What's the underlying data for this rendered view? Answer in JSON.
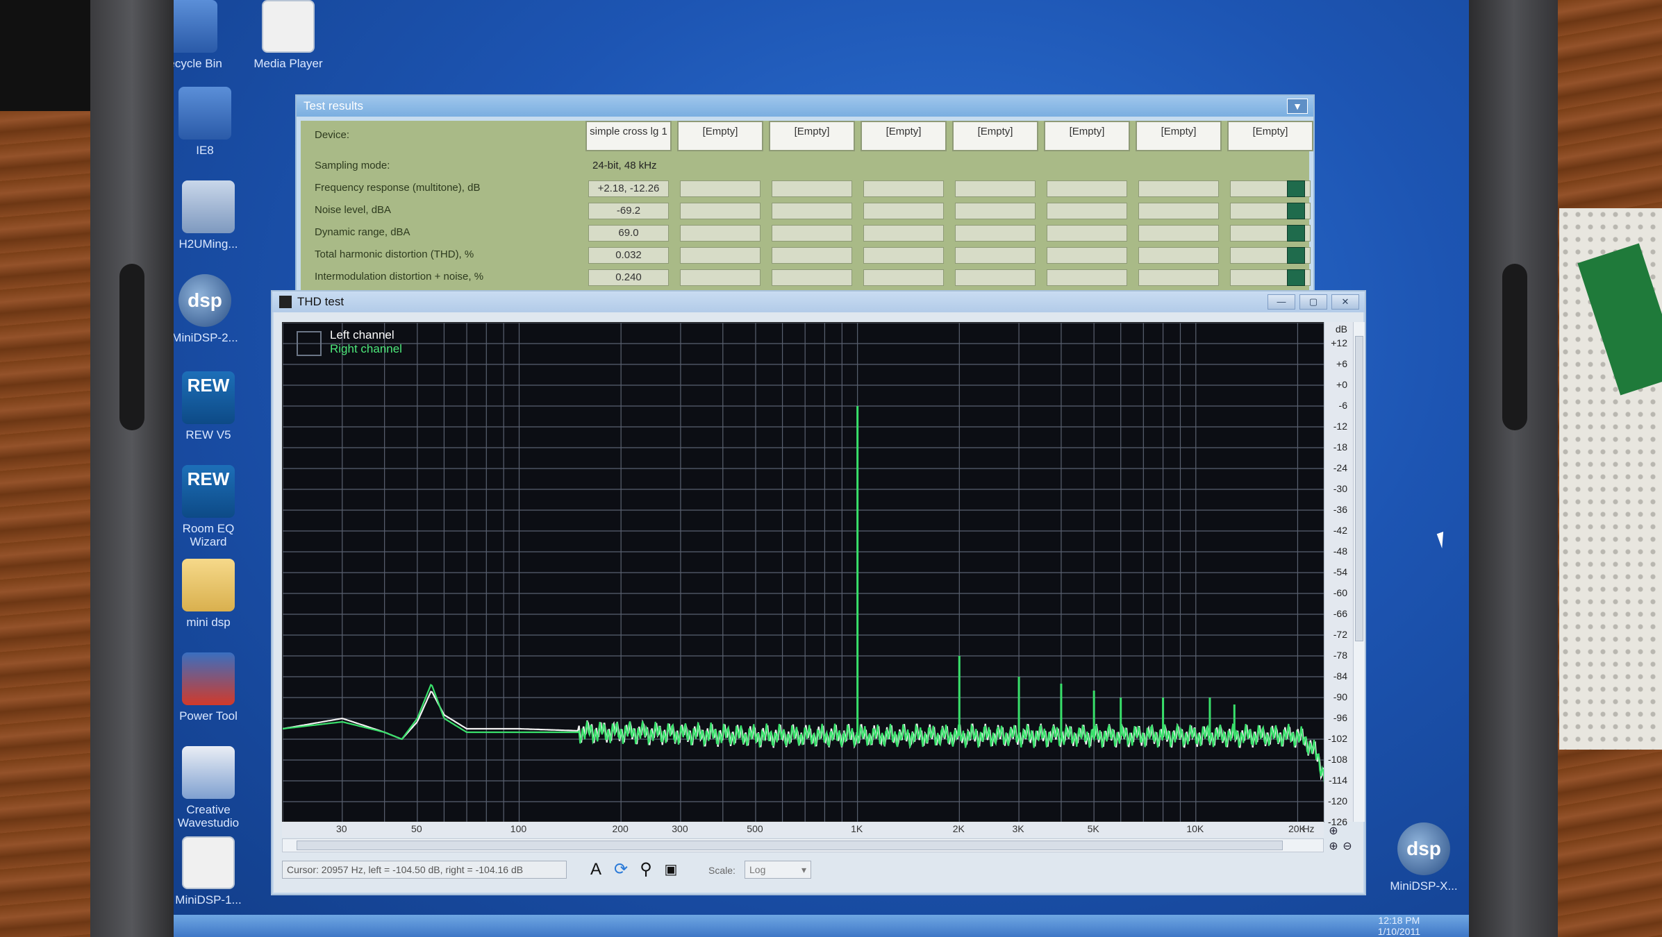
{
  "desktop": {
    "icons": [
      {
        "label": "Recycle Bin",
        "icon": "recycle-bin-icon"
      },
      {
        "label": "Media Player",
        "icon": "media-icon"
      },
      {
        "label": "IE8",
        "icon": "computer-icon"
      },
      {
        "label": "H2UMing...",
        "icon": "utility-icon"
      },
      {
        "label": "MiniDSP-2...",
        "icon": "minidsp-icon"
      },
      {
        "label": "REW V5",
        "icon": "rew-icon"
      },
      {
        "label": "Room EQ Wizard",
        "icon": "rew-icon"
      },
      {
        "label": "mini dsp",
        "icon": "folder-icon"
      },
      {
        "label": "Power Tool",
        "icon": "power-icon"
      },
      {
        "label": "Creative Wavestudio",
        "icon": "pen-icon"
      },
      {
        "label": "MiniDSP-1...",
        "icon": "document-icon"
      },
      {
        "label": "MiniDSP-X...",
        "icon": "minidsp-icon"
      }
    ],
    "rew_text": "REW"
  },
  "test_results": {
    "title": "Test results",
    "device_label": "Device:",
    "devices": [
      "simple cross lg 1",
      "[Empty]",
      "[Empty]",
      "[Empty]",
      "[Empty]",
      "[Empty]",
      "[Empty]",
      "[Empty]"
    ],
    "rows": [
      {
        "label": "Sampling mode:",
        "value": "24-bit, 48 kHz"
      },
      {
        "label": "Frequency response (multitone), dB",
        "value": "+2.18, -12.26"
      },
      {
        "label": "Noise level, dBA",
        "value": "-69.2"
      },
      {
        "label": "Dynamic range, dBA",
        "value": "69.0"
      },
      {
        "label": "Total harmonic distortion (THD), %",
        "value": "0.032"
      },
      {
        "label": "Intermodulation distortion + noise, %",
        "value": "0.240"
      }
    ]
  },
  "thd": {
    "title": "THD test",
    "legend_left": "Left channel",
    "legend_right": "Right channel",
    "unit_db": "dB",
    "unit_hz": "Hz",
    "cursor": "Cursor: 20957 Hz, left = -104.50 dB, right = -104.16 dB",
    "scale_label": "Scale:",
    "scale_value": "Log"
  },
  "chart_data": {
    "type": "line",
    "xscale": "log",
    "xlim": [
      20,
      24000
    ],
    "ylim": [
      -126,
      18
    ],
    "y_ticks": [
      "+12",
      "+6",
      "+0",
      "-6",
      "-12",
      "-18",
      "-24",
      "-30",
      "-36",
      "-42",
      "-48",
      "-54",
      "-60",
      "-66",
      "-72",
      "-78",
      "-84",
      "-90",
      "-96",
      "-102",
      "-108",
      "-114",
      "-120",
      "-126"
    ],
    "x_ticks": [
      "30",
      "50",
      "100",
      "200",
      "300",
      "500",
      "1K",
      "2K",
      "3K",
      "5K",
      "10K",
      "20K"
    ],
    "colors": {
      "left": "#f2f2f2",
      "right": "#39e06b",
      "grid": "#5a6170"
    },
    "series": [
      {
        "name": "Left channel",
        "x": [
          20,
          30,
          40,
          45,
          50,
          55,
          60,
          70,
          100,
          200,
          500,
          1000,
          2000,
          5000,
          10000,
          20000,
          22000,
          24000
        ],
        "y": [
          -99,
          -96,
          -100,
          -102,
          -97,
          -88,
          -95,
          -99,
          -99,
          -100,
          -101,
          -101,
          -101,
          -101,
          -101,
          -101,
          -104,
          -112
        ]
      },
      {
        "name": "Right channel",
        "x": [
          20,
          30,
          40,
          45,
          50,
          55,
          60,
          70,
          100,
          200,
          500,
          1000,
          2000,
          5000,
          10000,
          20000,
          22000,
          24000
        ],
        "y": [
          -99,
          -97,
          -100,
          -102,
          -96,
          -86,
          -96,
          -100,
          -100,
          -100,
          -101,
          -101,
          -101,
          -101,
          -101,
          -101,
          -104,
          -112
        ]
      }
    ],
    "peaks": [
      {
        "x": 1000,
        "y": -6
      },
      {
        "x": 2000,
        "y": -78
      },
      {
        "x": 3000,
        "y": -84
      },
      {
        "x": 4000,
        "y": -86
      },
      {
        "x": 5000,
        "y": -88
      },
      {
        "x": 6000,
        "y": -90
      },
      {
        "x": 8000,
        "y": -90
      },
      {
        "x": 11000,
        "y": -90
      },
      {
        "x": 13000,
        "y": -92
      }
    ]
  },
  "taskbar": {
    "time": "12:18 PM",
    "date": "1/10/2011"
  }
}
